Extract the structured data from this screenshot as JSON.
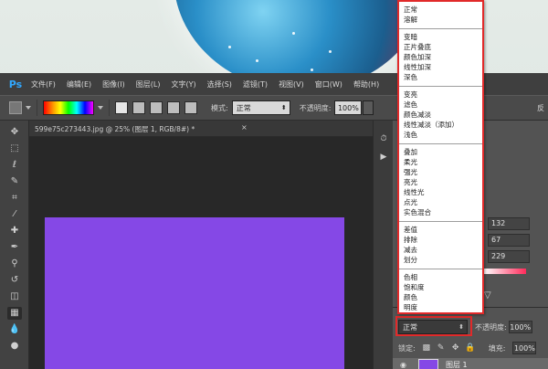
{
  "photoshop": {
    "logo": "Ps",
    "menu": [
      "文件(F)",
      "编辑(E)",
      "图像(I)",
      "图层(L)",
      "文字(Y)",
      "选择(S)",
      "滤镜(T)",
      "视图(V)",
      "窗口(W)",
      "帮助(H)"
    ]
  },
  "options_bar": {
    "mode_label": "模式:",
    "mode_value": "正常",
    "opacity_label": "不透明度:",
    "opacity_value": "100%",
    "reverse_label": "反"
  },
  "document": {
    "tab_label": "599e75c273443.jpg @ 25% (图层 1, RGB/8#) *",
    "close_icon": "×",
    "canvas_color": "#8548e6"
  },
  "color_panel": {
    "values": [
      "132",
      "67",
      "229"
    ]
  },
  "layers_panel": {
    "blend_mode": "正常",
    "opacity_label": "不透明度:",
    "opacity_value": "100%",
    "lock_label": "锁定:",
    "fill_label": "填充:",
    "fill_value": "100%",
    "layer_name": "图层 1"
  },
  "blend_dropdown": {
    "groups": [
      [
        "正常",
        "溶解"
      ],
      [
        "变暗",
        "正片叠底",
        "颜色加深",
        "线性加深",
        "深色"
      ],
      [
        "变亮",
        "滤色",
        "颜色减淡",
        "线性减淡（添加）",
        "浅色"
      ],
      [
        "叠加",
        "柔光",
        "强光",
        "亮光",
        "线性光",
        "点光",
        "实色混合"
      ],
      [
        "差值",
        "排除",
        "减去",
        "划分"
      ],
      [
        "色相",
        "饱和度",
        "颜色",
        "明度"
      ]
    ]
  },
  "colors": {
    "highlight": "#e12a2a",
    "canvas": "#8548e6"
  }
}
